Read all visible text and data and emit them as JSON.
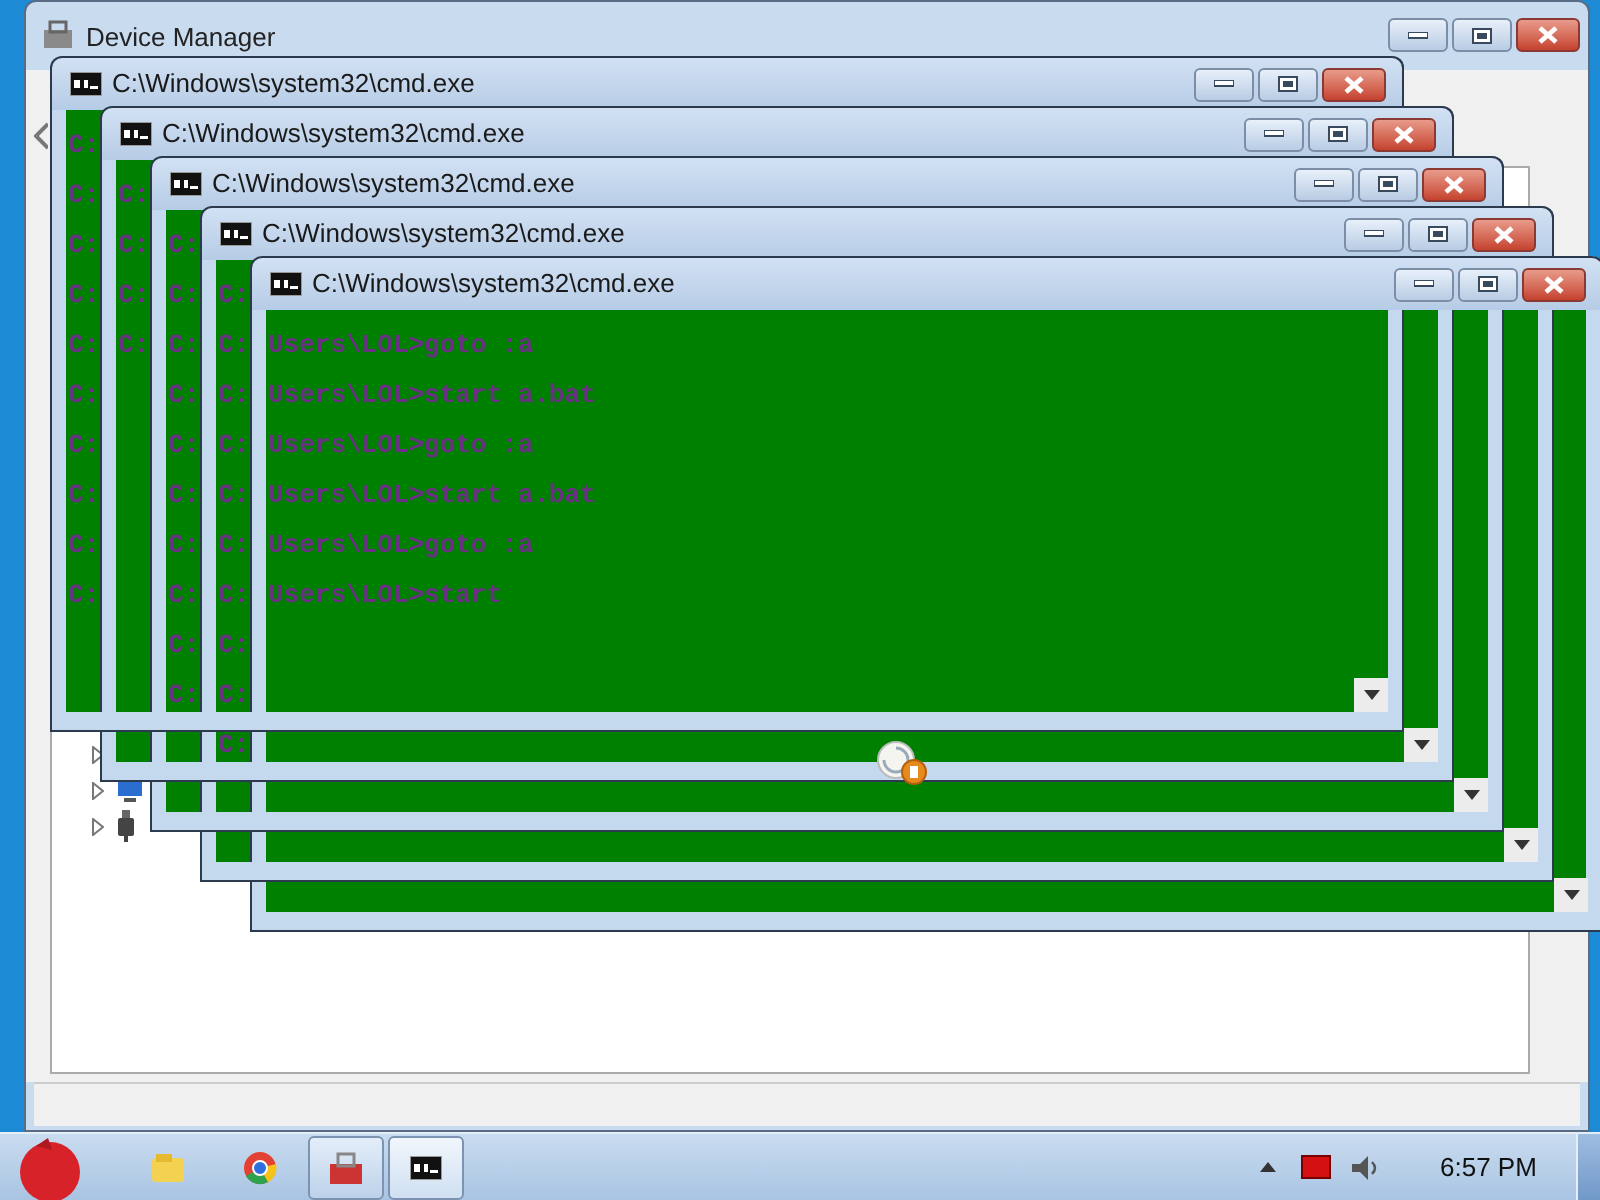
{
  "device_manager": {
    "title": "Device Manager"
  },
  "cmd_windows": [
    {
      "title": "C:\\Windows\\system32\\cmd.exe",
      "lines": [
        "C:",
        "C:",
        "C:",
        "C:",
        "C:",
        "C:",
        "C:",
        "C:",
        "C:",
        "C:"
      ]
    },
    {
      "title": "C:\\Windows\\system32\\cmd.exe",
      "lines": [
        "C:",
        "C:",
        "C:",
        "C:"
      ]
    },
    {
      "title": "C:\\Windows\\system32\\cmd.exe",
      "lines": [
        "C:",
        "C:",
        "C:",
        "C:",
        "C:",
        "C:",
        "C:",
        "C:",
        "C:",
        "C:"
      ]
    },
    {
      "title": "C:\\Windows\\system32\\cmd.exe",
      "lines": [
        "C:",
        "C:",
        "C:",
        "C:",
        "C:",
        "C:",
        "C:",
        "C:",
        "C:",
        "C:"
      ]
    },
    {
      "title": "C:\\Windows\\system32\\cmd.exe",
      "lines": [
        "Users\\LOL>goto :a",
        "Users\\LOL>start a.bat",
        "Users\\LOL>goto :a",
        "Users\\LOL>start a.bat",
        "Users\\LOL>goto :a",
        "Users\\LOL>start"
      ]
    }
  ],
  "taskbar": {
    "clock": "6:57 PM"
  }
}
